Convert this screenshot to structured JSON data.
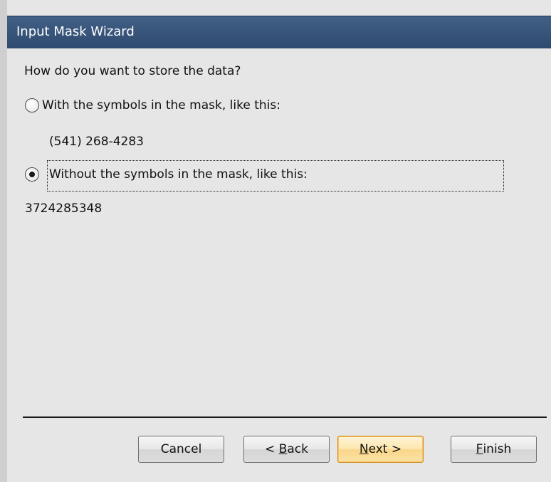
{
  "window": {
    "title": "Input Mask Wizard"
  },
  "question": "How do you want to store the data?",
  "options": [
    {
      "label": "With the symbols in the mask, like this:",
      "example": "(541) 268-4283",
      "selected": false
    },
    {
      "label": "Without the symbols in the mask, like this:",
      "example": "3724285348",
      "selected": true
    }
  ],
  "buttons": {
    "cancel": "Cancel",
    "back_prefix": "< ",
    "back_mnemonic": "B",
    "back_rest": "ack",
    "next_mnemonic": "N",
    "next_rest": "ext >",
    "finish_mnemonic": "F",
    "finish_rest": "inish"
  },
  "colors": {
    "titlebar": "#3a5680",
    "dialog_bg": "#e6e6e6",
    "default_button": "#fde7b0"
  }
}
